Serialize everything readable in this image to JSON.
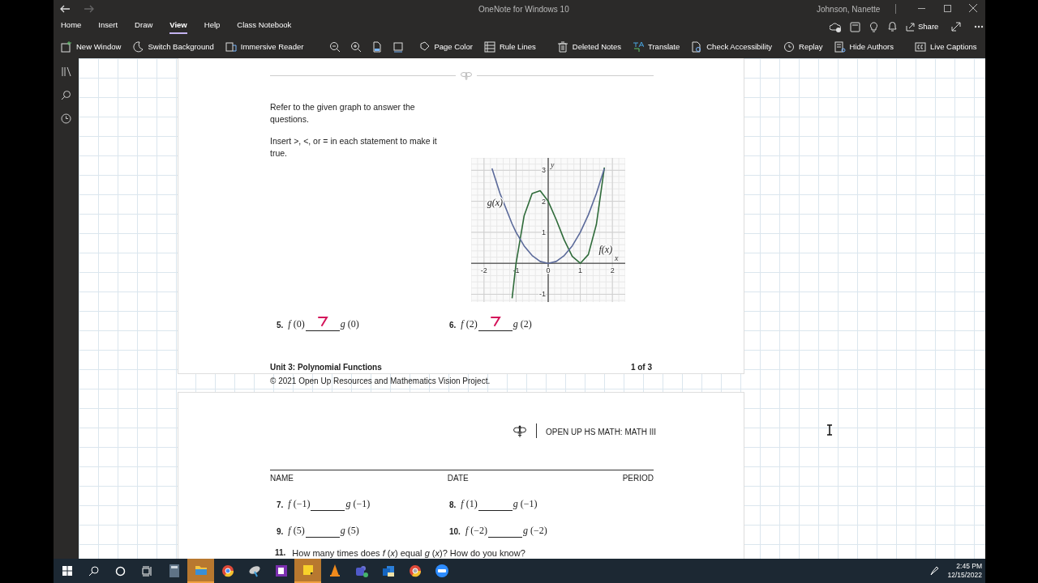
{
  "window": {
    "title": "OneNote for Windows 10",
    "user": "Johnson, Nanette"
  },
  "menu_tabs": [
    {
      "label": "Home",
      "selected": false
    },
    {
      "label": "Insert",
      "selected": false
    },
    {
      "label": "Draw",
      "selected": false
    },
    {
      "label": "View",
      "selected": true
    },
    {
      "label": "Help",
      "selected": false
    },
    {
      "label": "Class Notebook",
      "selected": false
    }
  ],
  "share_button": "Share",
  "toolbar": [
    {
      "label": "New Window"
    },
    {
      "label": "Switch Background"
    },
    {
      "label": "Immersive Reader"
    },
    {
      "kind": "divider"
    },
    {
      "kind": "icon"
    },
    {
      "kind": "icon"
    },
    {
      "kind": "icon"
    },
    {
      "kind": "icon"
    },
    {
      "kind": "divider"
    },
    {
      "label": "Page Color"
    },
    {
      "label": "Rule Lines"
    },
    {
      "kind": "divider"
    },
    {
      "label": "Deleted Notes"
    },
    {
      "label": "Translate"
    },
    {
      "label": "Check Accessibility"
    },
    {
      "label": "Replay"
    },
    {
      "label": "Hide Authors"
    },
    {
      "kind": "divider"
    },
    {
      "label": "Live Captions"
    }
  ],
  "page1": {
    "intro": "Refer to the given graph to answer the questions.",
    "instruction": "Insert >, <, or = in each statement to make it true.",
    "chart_data": {
      "type": "line",
      "x": [
        -1.75,
        -1.5,
        -1.125,
        -1,
        -0.75,
        -0.5,
        -0.25,
        0,
        0.25,
        0.5,
        0.75,
        1,
        1.25,
        1.5,
        1.75
      ],
      "series": [
        {
          "name": "f(x)",
          "color": "#2f6b3a",
          "values": [
            null,
            null,
            -1.13,
            0,
            1.53,
            2.25,
            2.34,
            2,
            1.41,
            0.75,
            0.22,
            0,
            0.28,
            1.25,
            3.09
          ]
        },
        {
          "name": "g(x)",
          "color": "#5b6a9a",
          "values": [
            3.06,
            2.25,
            1.27,
            1,
            0.56,
            0.25,
            0.06,
            0,
            0.06,
            0.25,
            0.56,
            1,
            1.56,
            2.25,
            3.06
          ]
        }
      ],
      "xlim": [
        -2.4,
        2.4
      ],
      "ylim": [
        -1.25,
        3.4
      ],
      "xticks": [
        -2,
        -1,
        0,
        1,
        2
      ],
      "yticks": [
        -1,
        1,
        2,
        3
      ],
      "xlabel": "x",
      "ylabel": "y",
      "grid": true
    },
    "problems": [
      {
        "num": "5.",
        "left": "f (0)",
        "right": "g (0)",
        "inked": true
      },
      {
        "num": "6.",
        "left": "f (2)",
        "right": "g (2)",
        "inked": true
      }
    ],
    "unit": "Unit 3: Polynomial Functions",
    "page_count": "1 of 3",
    "copyright": "© 2021 Open Up Resources and Mathematics Vision Project."
  },
  "page2": {
    "series": "OPEN UP HS MATH: MATH III",
    "fields": [
      "NAME",
      "DATE",
      "PERIOD"
    ],
    "problems": [
      {
        "num": "7.",
        "left": "f (−1)",
        "right": "g (−1)",
        "inked": false
      },
      {
        "num": "8.",
        "left": "f (1)",
        "right": "g (−1)",
        "inked": false
      },
      {
        "num": "9.",
        "left": "f (5)",
        "right": "g (5)",
        "inked": false
      },
      {
        "num": "10.",
        "left": "f (−2)",
        "right": "g (−2)",
        "inked": false
      }
    ],
    "question": {
      "num": "11.",
      "text": "How many times does *f* (*x*) equal *g* (*x*)? How do you know?"
    }
  },
  "taskbar": {
    "apps": [
      {
        "highlighted": false
      },
      {
        "highlighted": true
      },
      {
        "highlighted": false
      },
      {
        "highlighted": false
      },
      {
        "highlighted": false
      },
      {
        "highlighted": true
      },
      {
        "highlighted": false
      },
      {
        "highlighted": false
      },
      {
        "highlighted": false
      },
      {
        "highlighted": false
      },
      {
        "highlighted": false
      }
    ],
    "time": "2:45 PM",
    "date": "12/15/2022"
  }
}
